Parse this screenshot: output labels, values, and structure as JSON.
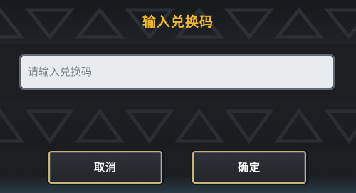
{
  "dialog": {
    "title": "输入兑换码",
    "input": {
      "value": "",
      "placeholder": "请输入兑换码"
    },
    "buttons": {
      "cancel_label": "取消",
      "confirm_label": "确定"
    }
  },
  "colors": {
    "title": "#f3bb2c",
    "background": "#1c1e21",
    "button_border": "#c9b27a",
    "input_bg": "#e9ecef"
  }
}
